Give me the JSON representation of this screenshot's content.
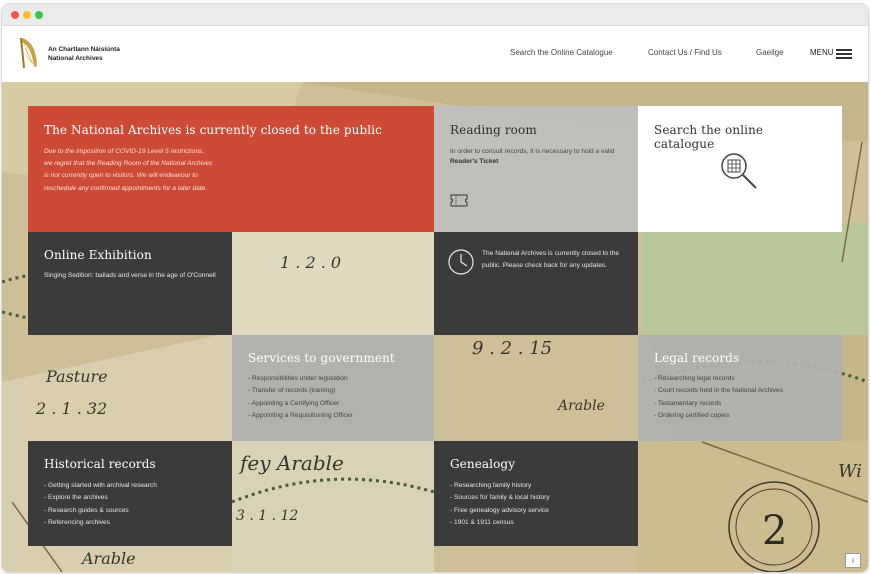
{
  "header": {
    "logo_line1": "An Chartlann Náisiúnta",
    "logo_line2": "National Archives",
    "nav": {
      "catalogue": "Search the Online Catalogue",
      "contact": "Contact Us / Find Us",
      "gaeilge": "Gaeilge",
      "menu": "MENU"
    }
  },
  "tiles": {
    "closed": {
      "title": "The National Archives is currently closed to the public",
      "body": "Due to the imposition of COVID-19 Level 5 restrictions, we regret that the Reading Room of the National Archives is not currently open to visitors. We will endeavour to reschedule any confirmed appointments for a later date."
    },
    "reading": {
      "title": "Reading room",
      "body": "In order to consult records, it is necessary to hold a valid",
      "ticket": "Reader's Ticket"
    },
    "search": {
      "title": "Search the online catalogue"
    },
    "online": {
      "title": "Online Exhibition",
      "body": "Singing Sedition: ballads and verse in the age of O'Connell"
    },
    "notice": {
      "body": "The National Archives is currently closed to the public. Please check back for any updates."
    },
    "services": {
      "title": "Services to government",
      "items": [
        "Responsibilities under legislation",
        "Transfer of records (training)",
        "Appointing a Certifying Officer",
        "Appointing a Requisitioning Officer"
      ]
    },
    "legal": {
      "title": "Legal records",
      "items": [
        "Researching legal records",
        "Court records held in the National Archives",
        "Testamentary records",
        "Ordering certified copies"
      ]
    },
    "historical": {
      "title": "Historical records",
      "items": [
        "Getting started with archival research",
        "Explore the archives",
        "Research guides & sources",
        "Referencing archives"
      ]
    },
    "genealogy": {
      "title": "Genealogy",
      "items": [
        "Researching family history",
        "Sources for family & local history",
        "Free genealogy advisory service",
        "1901 & 1911 census"
      ]
    }
  },
  "colors": {
    "accent_red": "#cc4a36",
    "dark_tile": "#3b3b3b",
    "grey_tile": "#bebebe"
  },
  "icons": [
    "harp-icon",
    "menu-icon",
    "ticket-icon",
    "search-icon",
    "clock-icon",
    "info-icon"
  ]
}
